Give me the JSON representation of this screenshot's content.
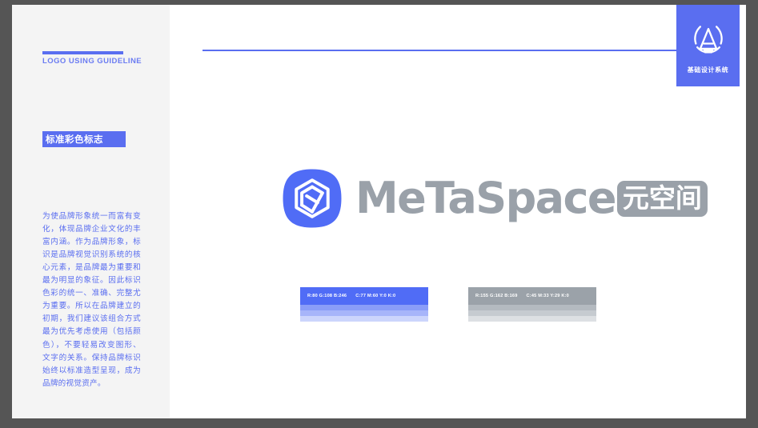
{
  "frame": {
    "border_color": "#555555",
    "page_background": "#ffffff"
  },
  "sidebar": {
    "background": "#f4f4f4",
    "rule_color": "#5a6ef0",
    "kicker": "LOGO USING GUIDELINE",
    "section_tag": "标准彩色标志",
    "section_tag_background": "#5a6ef0",
    "body_copy": "为使品牌形象统一而富有变化，体现品牌企业文化的丰富内涵。作为品牌形象，标识是品牌视觉识别系统的核心元素，是品牌最为重要和最为明显的象征。因此标识色彩的统一、准确、完整尤为重要。所以在品牌建立的初期，我们建议该组合方式最为优先考虑使用（包括颜色），不要轻易改变图形、文字的关系。保持品牌标识始终以标准造型呈现，成为品牌的视觉资产。",
    "body_copy_color": "#5a6ef0"
  },
  "header": {
    "rule_color": "#5a6ef0"
  },
  "corner_badge": {
    "label": "基础设计系统",
    "background": "#5a6ef0",
    "mark_name": "a-monogram-logo",
    "text_color": "#ffffff"
  },
  "logo": {
    "tile_color": "#5a6ef0",
    "mark_name": "hexagon-knot-logomark",
    "mark_color": "#ffffff",
    "wordmark_latin": "MeTaSpace",
    "wordmark_cjk": "元空间",
    "wordmark_color": "#9aa1a9",
    "wordmark_cjk_text_color": "#ffffff"
  },
  "swatches": [
    {
      "name": "primary-blue",
      "hex": "#506cf6",
      "rgb_label": "R:80 G:108 B:246",
      "cmyk_label": "C:77 M:60 Y:0 K:0",
      "label_color": "#ffffff",
      "tints": [
        "#8a9df8",
        "#a7b5fa",
        "#ccd5fc"
      ]
    },
    {
      "name": "secondary-gray",
      "hex": "#9ba2a9",
      "rgb_label": "R:155 G:162 B:169",
      "cmyk_label": "C:45 M:33 Y:29 K:0",
      "label_color": "#ffffff",
      "tints": [
        "#b4bac0",
        "#c6cbd0",
        "#dde0e3"
      ]
    }
  ]
}
